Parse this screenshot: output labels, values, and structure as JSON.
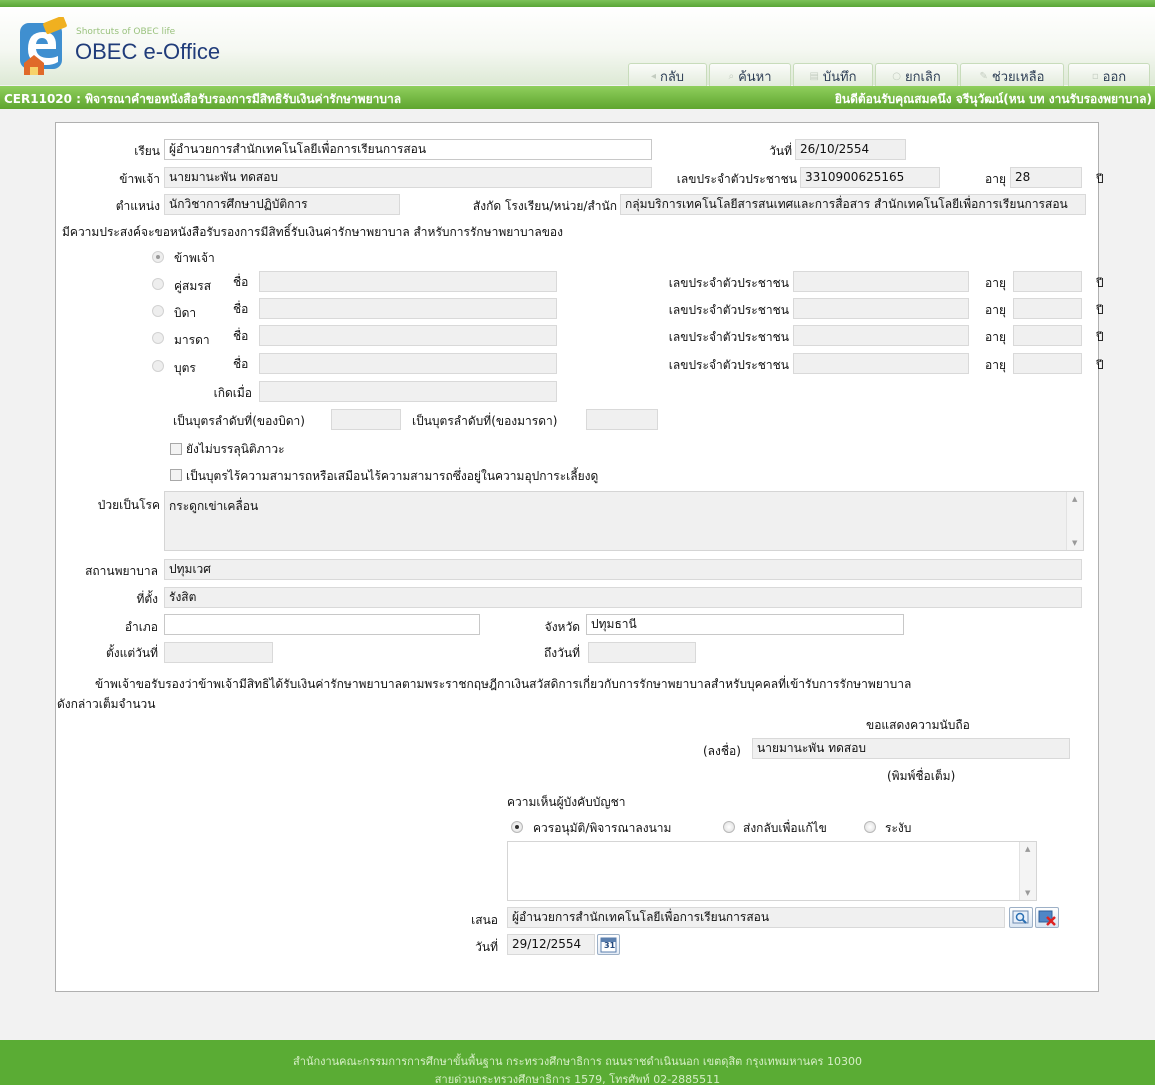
{
  "header": {
    "tagline": "Shortcuts of OBEC life",
    "brand": "OBEC e-Office",
    "toolbar": {
      "back": "กลับ",
      "search": "ค้นหา",
      "save": "บันทึก",
      "cancel": "ยกเลิก",
      "help": "ช่วยเหลือ",
      "exit": "ออก"
    }
  },
  "titlebar": {
    "form_title": "CER11020 : พิจารณาคำขอหนังสือรับรองการมีสิทธิรับเงินค่ารักษาพยาบาล",
    "welcome": "ยินดีต้อนรับคุณสมคนึง จรีนุวัฒน์(หน บท งานรับรองพยาบาล)"
  },
  "form": {
    "to_label": "เรียน",
    "to_value": "ผู้อำนวยการสำนักเทคโนโลยีเพื่อการเรียนการสอน",
    "date_label": "วันที่",
    "date_value": "26/10/2554",
    "i_label": "ข้าพเจ้า",
    "name_value": "นายมานะพัน ทดสอบ",
    "id_label": "เลขประจำตัวประชาชน",
    "id_value": "3310900625165",
    "age_label": "อายุ",
    "age_value": "28",
    "year_unit": "ปี",
    "position_label": "ตำแหน่ง",
    "position_value": "นักวิชาการศึกษาปฏิบัติการ",
    "affiliation_label": "สังกัด โรงเรียน/หน่วย/สำนัก",
    "affiliation_value": "กลุ่มบริการเทคโนโลยีสารสนเทศและการสื่อสาร  สำนักเทคโนโลยีเพื่อการเรียนการสอน",
    "purpose_text": "มีความประสงค์จะขอหนังสือรับรองการมีสิทธิ์รับเงินค่ารักษาพยาบาล สำหรับการรักษาพยาบาลของ",
    "patient_self": "ข้าพเจ้า",
    "patient_spouse": "คู่สมรส",
    "patient_father": "บิดา",
    "patient_mother": "มารดา",
    "patient_child": "บุตร",
    "name_label": "ชื่อ",
    "citizen_id_label": "เลขประจำตัวประชาชน",
    "age_label_short": "อายุ",
    "born_label": "เกิดเมื่อ",
    "child_order_father": "เป็นบุตรลำดับที่(ของบิดา)",
    "child_order_mother": "เป็นบุตรลำดับที่(ของมารดา)",
    "not_adult": "ยังไม่บรรลุนิติภาวะ",
    "incapable": "เป็นบุตรไร้ความสามารถหรือเสมือนไร้ความสามารถซึ่งอยู่ในความอุปการะเลี้ยงดู",
    "illness_label": "ป่วยเป็นโรค",
    "illness_value": "กระดูกเข่าเคลื่อน",
    "hospital_label": "สถานพยาบาล",
    "hospital_value": "ปทุมเวศ",
    "location_label": "ที่ตั้ง",
    "location_value": "รังสิต",
    "district_label": "อำเภอ",
    "district_value": "",
    "province_label": "จังหวัด",
    "province_value": "ปทุมธานี",
    "from_label": "ตั้งแต่วันที่",
    "to_date_label": "ถึงวันที่",
    "cert_line1": "ข้าพเจ้าขอรับรองว่าข้าพเจ้ามีสิทธิได้รับเงินค่ารักษาพยาบาลตามพระราชกฤษฎีกาเงินสวัสดิการเกี่ยวกับการรักษาพยาบาลสำหรับบุคคลที่เข้ารับการรักษาพยาบาล",
    "cert_line2": "ดังกล่าวเต็มจำนวน",
    "respect": "ขอแสดงความนับถือ",
    "sign_label": "(ลงชื่อ)",
    "sign_value": "นายมานะพัน ทดสอบ",
    "fullname_note": "(พิมพ์ชื่อเต็ม)",
    "supervisor_label": "ความเห็นผู้บังคับบัญชา",
    "opt_approve": "ควรอนุมัติ/พิจารณาลงนาม",
    "opt_return": "ส่งกลับเพื่อแก้ไข",
    "opt_suspend": "ระงับ",
    "propose_label": "เสนอ",
    "propose_value": "ผู้อำนวยการสำนักเทคโนโลยีเพื่อการเรียนการสอน",
    "sign_date_label": "วันที่",
    "sign_date_value": "29/12/2554",
    "calendar_day": "31"
  },
  "footer": {
    "line1": "สำนักงานคณะกรรมการการศึกษาขั้นพื้นฐาน กระทรวงศึกษาธิการ ถนนราชดำเนินนอก เขตดุสิต กรุงเทพมหานคร 10300",
    "line2": "สายด่วนกระทรวงศึกษาธิการ 1579, โทรศัพท์ 02-2885511"
  }
}
